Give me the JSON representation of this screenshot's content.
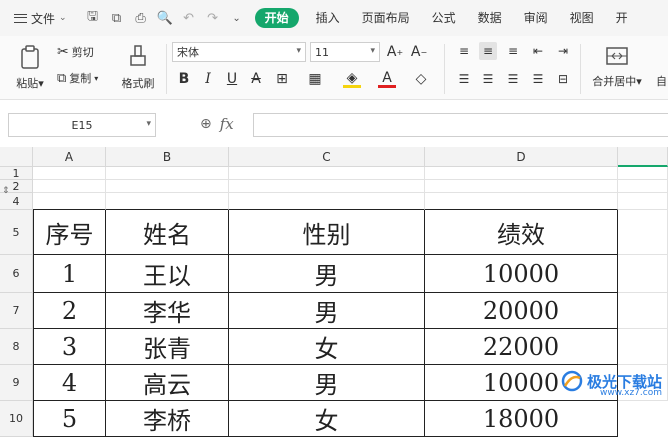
{
  "menu": {
    "file_label": "文件"
  },
  "tabs": [
    "开始",
    "插入",
    "页面布局",
    "公式",
    "数据",
    "审阅",
    "视图",
    "开"
  ],
  "ribbon": {
    "paste": "粘贴",
    "cut": "剪切",
    "copy": "复制",
    "format_painter": "格式刷",
    "font_name": "宋体",
    "font_size": "11",
    "merge_center": "合并居中",
    "auto": "自"
  },
  "formula_bar": {
    "cell_ref": "E15",
    "fx": "fx",
    "formula": ""
  },
  "grid": {
    "columns": [
      "A",
      "B",
      "C",
      "D"
    ],
    "rows": [
      "1",
      "2",
      "4",
      "5",
      "6",
      "7",
      "8",
      "9",
      "10"
    ],
    "header": [
      "序号",
      "姓名",
      "性别",
      "绩效"
    ],
    "records": [
      [
        "1",
        "王以",
        "男",
        "10000"
      ],
      [
        "2",
        "李华",
        "男",
        "20000"
      ],
      [
        "3",
        "张青",
        "女",
        "22000"
      ],
      [
        "4",
        "高云",
        "男",
        "10000"
      ],
      [
        "5",
        "李桥",
        "女",
        "18000"
      ]
    ]
  },
  "watermark": {
    "text": "极光下载站",
    "url": "www.xz7.com"
  },
  "colors": {
    "accent": "#15a76c",
    "watermark": "#2a7de1"
  }
}
